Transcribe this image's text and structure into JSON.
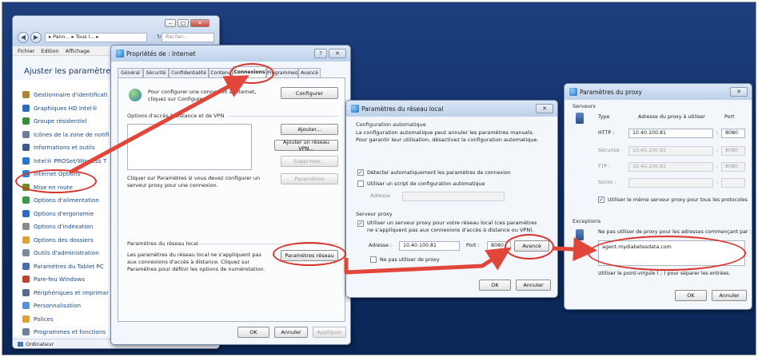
{
  "explorer": {
    "nav_path": "▸ Pann... ▸ Tous l... ▸",
    "search_placeholder": "Recher...",
    "menu": [
      "Fichier",
      "Edition",
      "Affichage"
    ],
    "heading": "Ajuster les paramètres",
    "items": [
      {
        "label": "Gestionnaire d'identificati",
        "icon": "credential-icon",
        "color": "#a8893a"
      },
      {
        "label": "Graphiques HD Intel®",
        "icon": "intel-graphics-icon",
        "color": "#2f6bb7"
      },
      {
        "label": "Groupe résidentiel",
        "icon": "homegroup-icon",
        "color": "#3a8c3a"
      },
      {
        "label": "Icônes de la zone de notifi",
        "icon": "notification-icon",
        "color": "#6a7d9a"
      },
      {
        "label": "Informations et outils",
        "icon": "performance-icon",
        "color": "#3c5a8a"
      },
      {
        "label": "Intel® PROSet/Wireless T",
        "icon": "wireless-icon",
        "color": "#2b76c8"
      },
      {
        "label": "Internet Options",
        "icon": "internet-options-icon",
        "color": "#2a86d1"
      },
      {
        "label": "Mise en route",
        "icon": "getting-started-icon",
        "color": "#6b8e2a"
      },
      {
        "label": "Options d'alimentation",
        "icon": "power-icon",
        "color": "#3a9a4a"
      },
      {
        "label": "Options d'ergonomie",
        "icon": "ergonomics-icon",
        "color": "#2d6cc0"
      },
      {
        "label": "Options d'indexation",
        "icon": "indexing-icon",
        "color": "#8c8c8c"
      },
      {
        "label": "Options des dossiers",
        "icon": "folder-options-icon",
        "color": "#d6a63a"
      },
      {
        "label": "Outils d'administration",
        "icon": "admin-tools-icon",
        "color": "#7a8aa0"
      },
      {
        "label": "Paramètres du Tablet PC",
        "icon": "tablet-icon",
        "color": "#4a6ea8"
      },
      {
        "label": "Pare-feu Windows",
        "icon": "firewall-icon",
        "color": "#b8452f"
      },
      {
        "label": "Périphériques et imprimar",
        "icon": "printer-icon",
        "color": "#556b8c"
      },
      {
        "label": "Personnalisation",
        "icon": "personalization-icon",
        "color": "#5a8fd0"
      },
      {
        "label": "Polices",
        "icon": "fonts-icon",
        "color": "#d9a23a"
      },
      {
        "label": "Programmes et fonctions",
        "icon": "programs-icon",
        "color": "#6d7f99"
      }
    ],
    "status": "Ordinateur"
  },
  "internet_props": {
    "title": "Propriétés de : Internet",
    "tabs": [
      "Général",
      "Sécurité",
      "Confidentialité",
      "Contenu",
      "Connexions",
      "Programmes",
      "Avancé"
    ],
    "active_tab": "Connexions",
    "setup_text": "Pour configurer une connexion à Internet, cliquez sur Configurer.",
    "setup_button": "Configurer",
    "dialup_section": "Options d'accès à distance et de VPN",
    "add_button": "Ajouter...",
    "add_vpn_button": "Ajouter un réseau VPN...",
    "remove_button": "Supprimer...",
    "settings_button": "Paramètres",
    "proxy_hint": "Cliquer sur Paramètres si vous devez configurer un serveur proxy pour une connexion.",
    "lan_section": "Paramètres du réseau local",
    "lan_text": "Les paramètres du réseau local ne s'appliquent pas aux connexions d'accès à distance. Cliquez sur Paramètres pour définir les options de numérotation.",
    "lan_button": "Paramètres réseau",
    "ok": "OK",
    "cancel": "Annuler",
    "apply": "Appliquer"
  },
  "lan_settings": {
    "title": "Paramètres du réseau local",
    "auto_section": "Configuration automatique",
    "auto_text": "La configuration automatique peut annuler les paramètres manuels. Pour garantir leur utilisation, désactivez la configuration automatique.",
    "auto_detect": "Détecter automatiquement les paramètres de connexion",
    "use_script": "Utiliser un script de configuration automatique",
    "address_label_dim": "Adresse",
    "proxy_section": "Serveur proxy",
    "use_proxy": "Utiliser un serveur proxy pour votre réseau local (ces paramètres ne s'appliquent pas aux connexions d'accès à distance ou VPN).",
    "address_label": "Adresse :",
    "address_value": "10.40.100.81",
    "port_label": "Port :",
    "port_value": "8080",
    "advanced_button": "Avancé",
    "bypass_partial": "Ne pas utiliser de proxy",
    "ok": "OK",
    "cancel": "Annuler"
  },
  "proxy_settings": {
    "title": "Paramètres du proxy",
    "servers_section": "Serveurs",
    "col_type": "Type",
    "col_address": "Adresse du proxy à utiliser",
    "col_port": "Port",
    "rows": [
      {
        "type": "HTTP :",
        "address": "10.40.100.81",
        "port": "8080",
        "enabled": true
      },
      {
        "type": "Sécurisé :",
        "address": "10.40.100.81",
        "port": "8080",
        "enabled": false
      },
      {
        "type": "FTP :",
        "address": "10.40.100.81",
        "port": "8080",
        "enabled": false
      },
      {
        "type": "Socks :",
        "address": "",
        "port": "",
        "enabled": false
      }
    ],
    "same_proxy": "Utiliser le même serveur proxy pour tous les protocoles",
    "exceptions_section": "Exceptions",
    "exceptions_text": "Ne pas utiliser de proxy pour les adresses commençant par :",
    "exceptions_value": "agent.mydiabetesdata.com",
    "separator_hint": "Utiliser le point-virgule ( ; ) pour séparer les entrées.",
    "ok": "OK",
    "cancel": "Annuler"
  }
}
